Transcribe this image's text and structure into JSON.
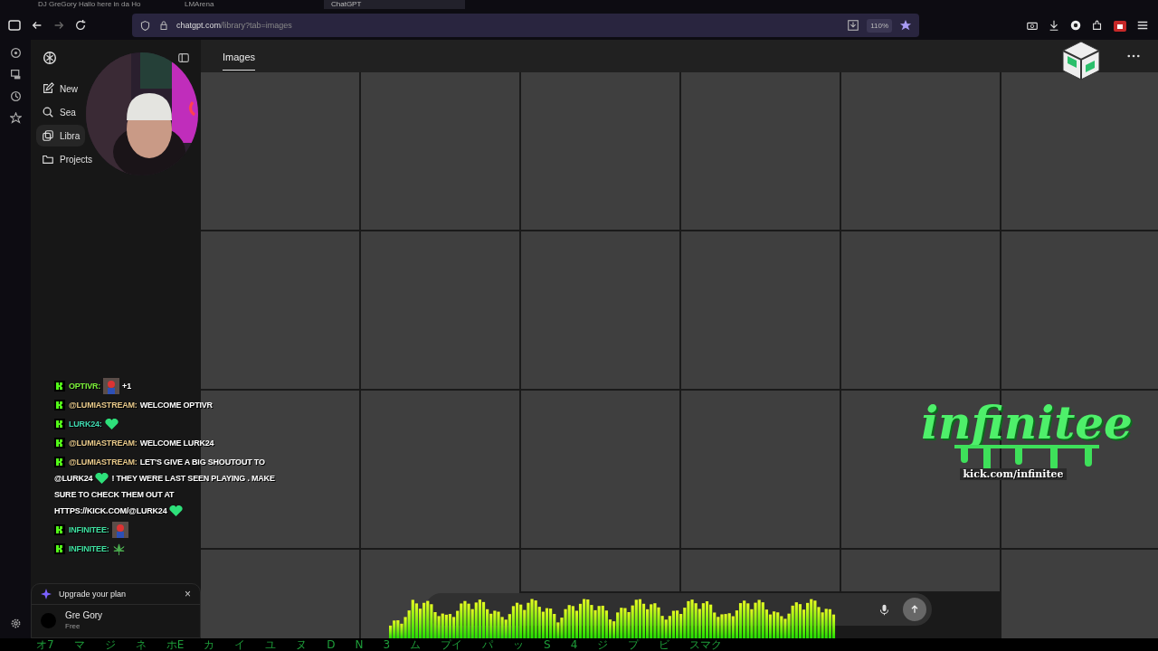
{
  "browser": {
    "tabs": [
      {
        "title": "DJ GreGory Hallo here in da Ho",
        "selected": false
      },
      {
        "title": "LMArena",
        "selected": false
      },
      {
        "title": "ChatGPT",
        "selected": true
      }
    ],
    "address": {
      "host": "chatgpt.com",
      "path": "/library?tab=images"
    },
    "zoom": "110%"
  },
  "sidebar": {
    "items": [
      {
        "label": "New",
        "kind": "new",
        "selected": false
      },
      {
        "label": "Sea",
        "kind": "search",
        "selected": false
      },
      {
        "label": "Libra",
        "kind": "library",
        "selected": true
      },
      {
        "label": "Projects",
        "kind": "projects",
        "selected": false
      }
    ],
    "upgrade": {
      "label": "Upgrade your plan",
      "close": "×"
    },
    "user": {
      "name": "Gre Gory",
      "plan": "Free"
    }
  },
  "main": {
    "tabs": [
      {
        "label": "Images",
        "selected": true
      }
    ]
  },
  "chat": [
    {
      "user": "OPTIVR:",
      "color": "#7cf23a",
      "parts": [
        {
          "kind": "emote"
        },
        {
          "kind": "text",
          "text": "+1"
        }
      ]
    },
    {
      "user": "@LUMIASTREAM:",
      "color": "#e8c98a",
      "parts": [
        {
          "kind": "text",
          "text": "WELCOME OPTIVR"
        }
      ]
    },
    {
      "user": "LURK24:",
      "color": "#3fd9b0",
      "parts": [
        {
          "kind": "heart"
        }
      ]
    },
    {
      "user": "@LUMIASTREAM:",
      "color": "#e8c98a",
      "parts": [
        {
          "kind": "text",
          "text": "WELCOME LURK24"
        }
      ]
    },
    {
      "user": "@LUMIASTREAM:",
      "color": "#e8c98a",
      "parts": [
        {
          "kind": "text",
          "text": "LET'S GIVE A BIG SHOUTOUT TO"
        },
        {
          "kind": "text",
          "text": "@LURK24"
        },
        {
          "kind": "heart"
        },
        {
          "kind": "text",
          "text": "! THEY WERE LAST SEEN PLAYING . MAKE"
        },
        {
          "kind": "text",
          "text": "SURE TO CHECK THEM OUT AT"
        },
        {
          "kind": "text",
          "text": "HTTPS://KICK.COM/@LURK24"
        },
        {
          "kind": "heart"
        }
      ]
    },
    {
      "user": "INFINITEE:",
      "color": "#3fe0a0",
      "parts": [
        {
          "kind": "emote"
        }
      ]
    },
    {
      "user": "INFINITEE:",
      "color": "#3fe0a0",
      "parts": [
        {
          "kind": "leaf"
        }
      ]
    }
  ],
  "logo": {
    "title": "infinitee",
    "url": "kick.com/infinitee"
  },
  "ticker": [
    "オ7",
    "マ",
    "ジ",
    "ネ",
    "ホE",
    "カ",
    "イ",
    "ユ",
    "ヌ",
    "D",
    "N",
    "3",
    "ム",
    "プイ",
    "パ",
    "ッ",
    "S",
    "4",
    "ジ",
    "プ",
    "ビ",
    "スマク"
  ]
}
